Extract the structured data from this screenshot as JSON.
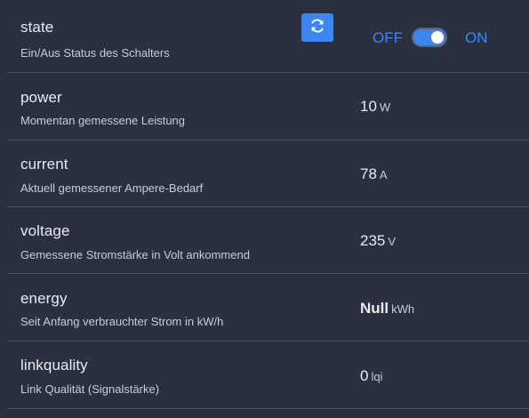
{
  "colors": {
    "background": "#2b3040",
    "accent": "#3d86f0",
    "divider": "#4a5062"
  },
  "state": {
    "name": "state",
    "description": "Ein/Aus Status des Schalters",
    "refresh_icon": "refresh-icon",
    "off_label": "OFF",
    "on_label": "ON",
    "toggle_on": true
  },
  "rows": [
    {
      "name": "power",
      "description": "Momentan gemessene Leistung",
      "value": "10",
      "unit": "W"
    },
    {
      "name": "current",
      "description": "Aktuell gemessener Ampere-Bedarf",
      "value": "78",
      "unit": "A"
    },
    {
      "name": "voltage",
      "description": "Gemessene Stromstärke in Volt ankommend",
      "value": "235",
      "unit": "V"
    },
    {
      "name": "energy",
      "description": "Seit Anfang verbrauchter Strom in kW/h",
      "value": "Null",
      "unit": "kWh"
    },
    {
      "name": "linkquality",
      "description": "Link Qualität (Signalstärke)",
      "value": "0",
      "unit": "lqi"
    }
  ]
}
